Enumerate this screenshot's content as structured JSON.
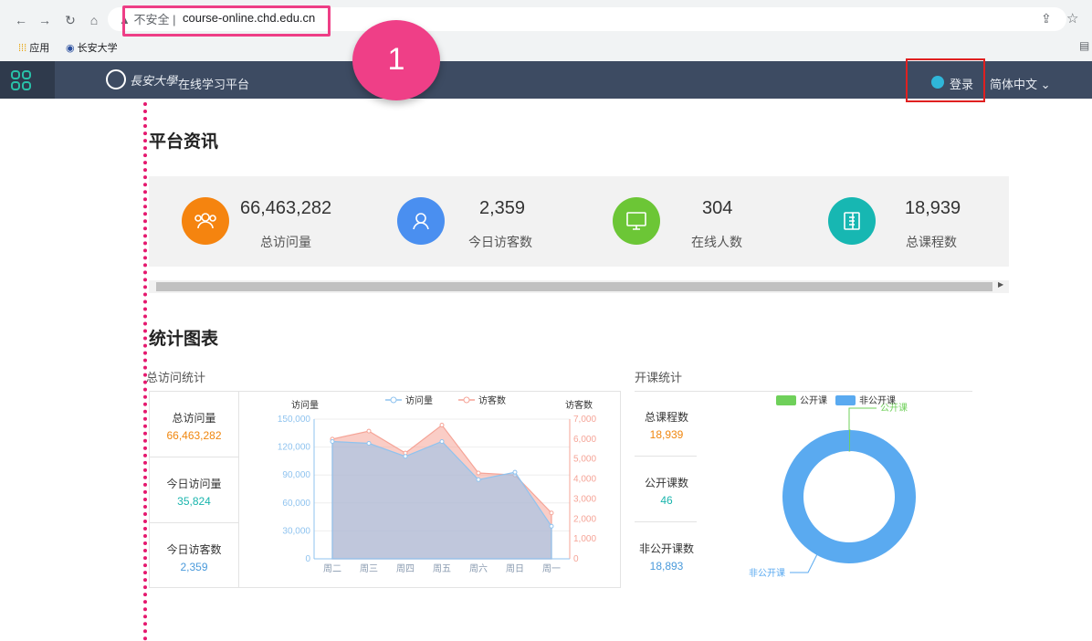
{
  "browser": {
    "security_label": "不安全",
    "url": "course-online.chd.edu.cn",
    "bookmarks": [
      "应用",
      "长安大学"
    ]
  },
  "annotation": {
    "step_number": "1"
  },
  "site": {
    "platform_name": "在线学习平台",
    "login_label": "登录",
    "language_label": "简体中文"
  },
  "news": {
    "title": "平台资讯",
    "stats": [
      {
        "value": "66,463,282",
        "label": "总访问量",
        "color": "#f5840f",
        "icon": "users-icon"
      },
      {
        "value": "2,359",
        "label": "今日访客数",
        "color": "#4a8ff0",
        "icon": "user-icon"
      },
      {
        "value": "304",
        "label": "在线人数",
        "color": "#6cc636",
        "icon": "monitor-icon"
      },
      {
        "value": "18,939",
        "label": "总课程数",
        "color": "#17b7b2",
        "icon": "book-icon"
      }
    ]
  },
  "charts_section": {
    "title": "统计图表",
    "visit_title": "总访问统计",
    "course_title": "开课统计",
    "visit_kpis": [
      {
        "label": "总访问量",
        "value": "66,463,282"
      },
      {
        "label": "今日访问量",
        "value": "35,824"
      },
      {
        "label": "今日访客数",
        "value": "2,359"
      }
    ],
    "course_kpis": [
      {
        "label": "总课程数",
        "value": "18,939"
      },
      {
        "label": "公开课数",
        "value": "46"
      },
      {
        "label": "非公开课数",
        "value": "18,893"
      }
    ]
  },
  "chart_data": [
    {
      "type": "area",
      "categories": [
        "周二",
        "周三",
        "周四",
        "周五",
        "周六",
        "周日",
        "周一"
      ],
      "series": [
        {
          "name": "访问量",
          "axis": "left",
          "values": [
            126000,
            124000,
            110000,
            126000,
            85000,
            93000,
            35000
          ],
          "color": "#8fc3ef"
        },
        {
          "name": "访客数",
          "axis": "right",
          "values": [
            6000,
            6400,
            5300,
            6700,
            4300,
            4200,
            2300
          ],
          "color": "#f5a497"
        }
      ],
      "ylabel_left": "访问量",
      "ylabel_right": "访客数",
      "ylim_left": [
        0,
        150000
      ],
      "ylim_right": [
        0,
        7000
      ],
      "yticks_left": [
        "0",
        "30,000",
        "60,000",
        "90,000",
        "120,000",
        "150,000"
      ],
      "yticks_right": [
        "0",
        "1,000",
        "2,000",
        "3,000",
        "4,000",
        "5,000",
        "6,000",
        "7,000"
      ],
      "legend_position": "top-center"
    },
    {
      "type": "pie",
      "style": "donut",
      "slices": [
        {
          "label": "公开课",
          "value": 46,
          "color": "#6fd05a"
        },
        {
          "label": "非公开课",
          "value": 18893,
          "color": "#5aaaf0"
        }
      ],
      "legend_position": "top"
    }
  ]
}
